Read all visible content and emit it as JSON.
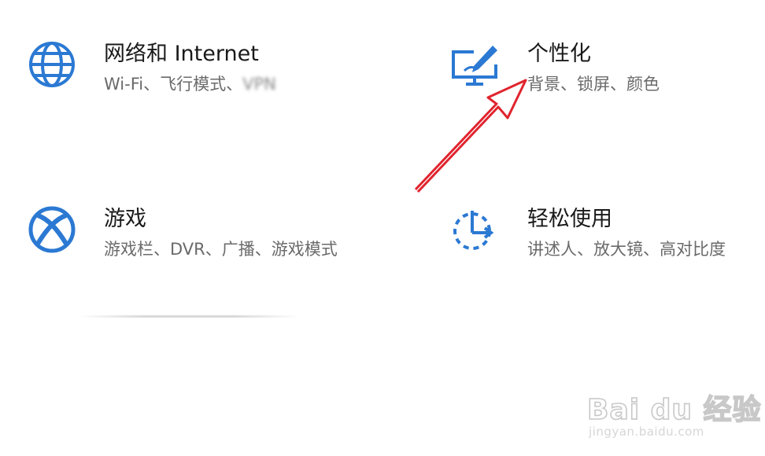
{
  "tiles": {
    "network": {
      "title": "网络和 Internet",
      "desc": "Wi-Fi、飞行模式、",
      "desc_blurred": "VPN",
      "icon": "globe-icon"
    },
    "personalization": {
      "title": "个性化",
      "desc": "背景、锁屏、颜色",
      "icon": "personalization-icon"
    },
    "gaming": {
      "title": "游戏",
      "desc": "游戏栏、DVR、广播、游戏模式",
      "icon": "xbox-icon"
    },
    "ease_of_access": {
      "title": "轻松使用",
      "desc": "讲述人、放大镜、高对比度",
      "icon": "ease-of-access-icon"
    }
  },
  "annotation": {
    "arrow_color": "#e0242e"
  },
  "watermark": {
    "brand": "Bai du 经验",
    "url": "jingyan.baidu.com"
  },
  "colors": {
    "accent": "#2b79d3",
    "title": "#1a1a1a",
    "desc": "#6a6a6a"
  }
}
